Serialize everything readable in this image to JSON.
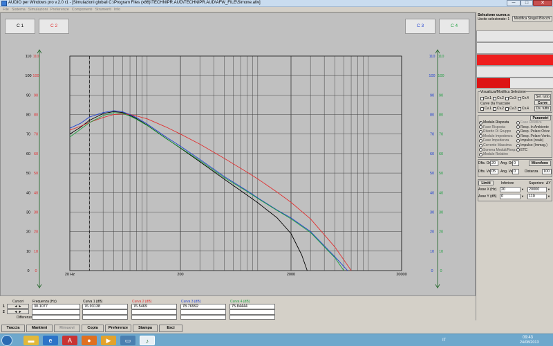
{
  "window": {
    "title": "AUDIO per Windows pro v.2.0 r1 - [Simulazioni globali C:\\Program Files (x86)\\TECHNIPR.AUD\\TECHNIPR.AUD\\AFW_FILE\\Simone.afw]",
    "minimize": "─",
    "maximize": "□",
    "close": "✕"
  },
  "menu": [
    "File",
    "Sistema",
    "Simulazioni",
    "Preferenze",
    "Componenti",
    "Strumenti",
    "Info"
  ],
  "curve_buttons": {
    "c1": "C 1",
    "c2": "C 2",
    "c3": "C 3",
    "c4": "C 4"
  },
  "colors": {
    "curve1": "#000000",
    "curve2": "#e03030",
    "curve3": "#2040d0",
    "curve4": "#20a040",
    "grid": "#444444"
  },
  "chart_data": {
    "type": "line",
    "x_scale": "log",
    "xlim": [
      20,
      20000
    ],
    "ylim": [
      0,
      110
    ],
    "x_tick_labels": [
      "20 Hz",
      "200",
      "2000",
      "20000"
    ],
    "y_ticks": [
      0,
      10,
      20,
      30,
      40,
      50,
      60,
      70,
      80,
      90,
      100,
      110
    ],
    "cursor_x": 30.1077,
    "grid": true,
    "series": [
      {
        "name": "Curva 1 (dB)",
        "color": "#000000",
        "x": [
          20,
          25,
          30,
          40,
          50,
          60,
          70,
          80,
          100,
          150,
          200,
          300,
          500,
          800,
          1000,
          1500,
          2000,
          2500,
          2800
        ],
        "y": [
          70,
          73.5,
          77,
          80.5,
          81.5,
          81,
          79.6,
          78,
          74.6,
          67.6,
          62.8,
          55.8,
          46.8,
          38.7,
          34.8,
          27,
          19,
          8,
          0
        ]
      },
      {
        "name": "Curva 2 (dB)",
        "color": "#e03030",
        "x": [
          20,
          25,
          30,
          40,
          50,
          60,
          70,
          80,
          100,
          150,
          200,
          300,
          500,
          800,
          1000,
          1500,
          2000,
          3000,
          5000,
          7000
        ],
        "y": [
          72,
          74,
          76,
          78.5,
          80,
          80.3,
          80,
          79.3,
          77.8,
          73.5,
          70,
          64.8,
          57.5,
          50.5,
          47,
          40.2,
          35,
          26.5,
          12,
          0
        ]
      },
      {
        "name": "Curva 3 (dB)",
        "color": "#2040d0",
        "x": [
          20,
          25,
          30,
          40,
          50,
          60,
          70,
          80,
          100,
          150,
          200,
          300,
          500,
          800,
          1000,
          1500,
          2000,
          3000,
          5000,
          6500
        ],
        "y": [
          73,
          75.5,
          78.7,
          81,
          82,
          81.4,
          80,
          78.5,
          75.2,
          68.3,
          63.8,
          57,
          48.2,
          41,
          37.3,
          31,
          27,
          20,
          7,
          0
        ]
      },
      {
        "name": "Curva 4 (dB)",
        "color": "#20a040",
        "x": [
          20,
          25,
          30,
          40,
          50,
          60,
          70,
          80,
          100,
          150,
          200,
          300,
          500,
          800,
          1000,
          1500,
          2000,
          3000,
          5000,
          6000
        ],
        "y": [
          68.5,
          72.5,
          75.8,
          79.5,
          81,
          80.6,
          79.2,
          77.6,
          74.4,
          67.5,
          63,
          56.3,
          47.6,
          40.6,
          37,
          30.8,
          26.5,
          19.5,
          6.5,
          0
        ]
      }
    ]
  },
  "right_panel": {
    "header": "Selezione curva a",
    "uscite_label": "Uscite selezionate: 1",
    "modifica_btn": "Modifica Singoli Blocchi",
    "visualizza": {
      "title": "Visualizza/Modifica Selezione",
      "items": [
        "Cv.1",
        "Cv.2",
        "Cv.3",
        "Cv.4"
      ],
      "sel_btn": "Sel. tutto"
    },
    "curve_da_tracciare": {
      "title": "Curve Da Tracciare",
      "items": [
        "Cv.1",
        "Cv.2",
        "Cv.3",
        "Cv.4"
      ],
      "btn": "Curve",
      "desel_btn": "Ds. tutto"
    },
    "parametri_btn": "Parametri",
    "options_left": [
      "Modulo Risposta",
      "Fase Risposta",
      "Ritardo Di Gruppo",
      "Modulo Impedenza",
      "Fase Impedenza",
      "Corrente Massima",
      "Somma Moduli/Resp.",
      "Modulo Relativo"
    ],
    "options_right": [
      "Fase Relativa",
      "Resp. In Ambiente",
      "Resp. Polare Orizz.",
      "Resp. Polare Vertic.",
      "Impulso (reale)",
      "Impulso (Immag.)",
      "ETC"
    ],
    "dist": {
      "or_label": "Dfts. Or.",
      "or_value": "20",
      "ang_or_label": "Ang. Or.",
      "ang_or_value": "0",
      "ve_label": "Dfts. Ve.",
      "ve_value": "05",
      "ang_ve_label": "Ang. Ve.",
      "ang_ve_value": "0",
      "distanza_label": "Distanza",
      "distanza_value": "100",
      "microfono_btn": "Microfono"
    },
    "limits": {
      "limiti_btn": "Limiti",
      "inferiore": "Inferiore",
      "superiore": "Superiore",
      "delta": "ΔY",
      "asse_x": "Asse X",
      "x_unit": "(Hz)",
      "x_inf": "20",
      "x_sup": "20000",
      "asse_y": "Asse Y",
      "y_unit": "(dB)",
      "y_inf": "0",
      "y_sup": "110"
    }
  },
  "cursor_table": {
    "cursori": "Cursori",
    "frequenza": "Frequenza (Hz)",
    "freq_value": "30.1077",
    "differenza": "Differenza",
    "row1": "1",
    "row2": "2",
    "curve_labels": [
      "Curva 1 (dB)",
      "Curva 2 (dB)",
      "Curva 3 (dB)",
      "Curva 4 (dB)"
    ],
    "curve_values": [
      "76.93138",
      "76.5469",
      "78.76992",
      "75.84444"
    ]
  },
  "toolbar": [
    "Traccia",
    "Mantieni",
    "Rimuovi",
    "Copia",
    "Preferenze",
    "Stampa",
    "Esci"
  ],
  "taskbar": {
    "lang": "IT",
    "time": "09:43",
    "date": "24/08/2013"
  }
}
